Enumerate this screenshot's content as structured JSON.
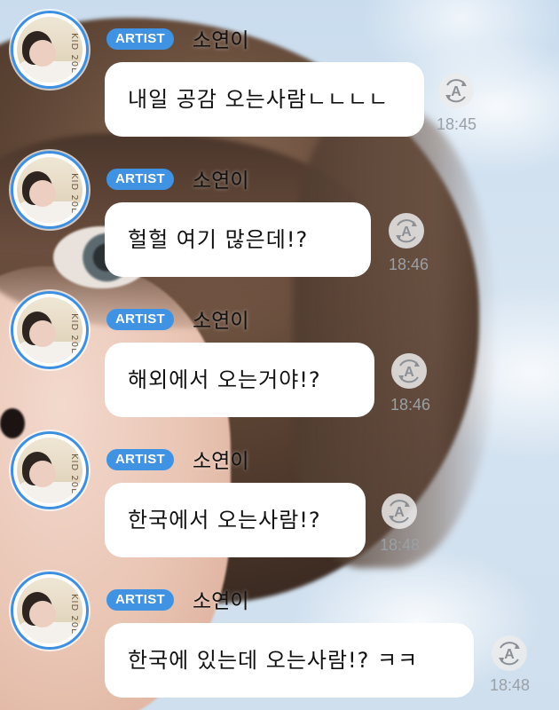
{
  "messages": [
    {
      "badge": "ARTIST",
      "sender": "소연이",
      "text": "내일 공감 오는사람ㄴㄴㄴㄴ",
      "time": "18:45",
      "avatar_text": "KID 20L"
    },
    {
      "badge": "ARTIST",
      "sender": "소연이",
      "text": "헐헐 여기 많은데!?",
      "time": "18:46",
      "avatar_text": "KID 20L"
    },
    {
      "badge": "ARTIST",
      "sender": "소연이",
      "text": "해외에서 오는거야!?",
      "time": "18:46",
      "avatar_text": "KID 20L"
    },
    {
      "badge": "ARTIST",
      "sender": "소연이",
      "text": "한국에서 오는사람!?",
      "time": "18:48",
      "avatar_text": "KID 20L"
    },
    {
      "badge": "ARTIST",
      "sender": "소연이",
      "text": "한국에 있는데 오는사람!? ㅋㅋ",
      "time": "18:48",
      "avatar_text": "KID 20L"
    }
  ],
  "reply_icon_letter": "A",
  "colors": {
    "badge": "#3f93e2",
    "avatar_ring": "#3d8fe0",
    "bubble": "#ffffff",
    "time": "#9aa0a6"
  }
}
